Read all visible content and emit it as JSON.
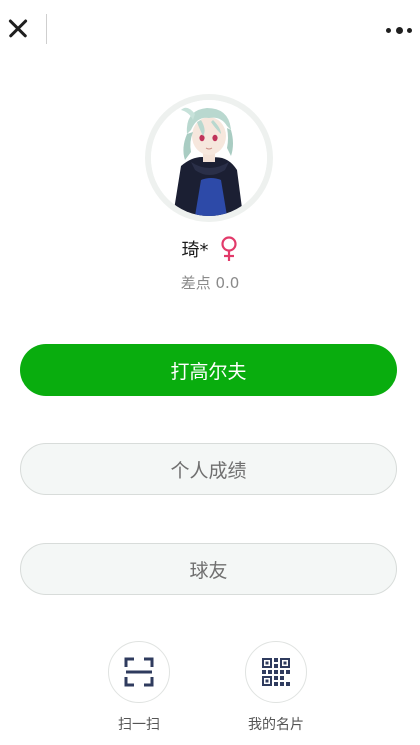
{
  "header": {
    "close_icon": "close-icon",
    "more_icon": "more-dots-icon"
  },
  "profile": {
    "avatar": "anime-character-avatar",
    "name": "琦*",
    "gender_icon": "female-symbol-icon",
    "handicap_label": "差点 0.0"
  },
  "actions": {
    "play_golf_label": "打高尔夫",
    "my_scores_label": "个人成绩",
    "friends_label": "球友"
  },
  "shortcuts": {
    "scan_label": "扫一扫",
    "scan_icon": "scan-icon",
    "card_label": "我的名片",
    "card_icon": "qr-code-icon"
  },
  "colors": {
    "primary_green": "#09ad0e",
    "female_pink": "#e23a6a",
    "secondary_bg": "#f4f7f6",
    "secondary_border": "#d8dcda",
    "icon_navy": "#2f3b5e"
  }
}
